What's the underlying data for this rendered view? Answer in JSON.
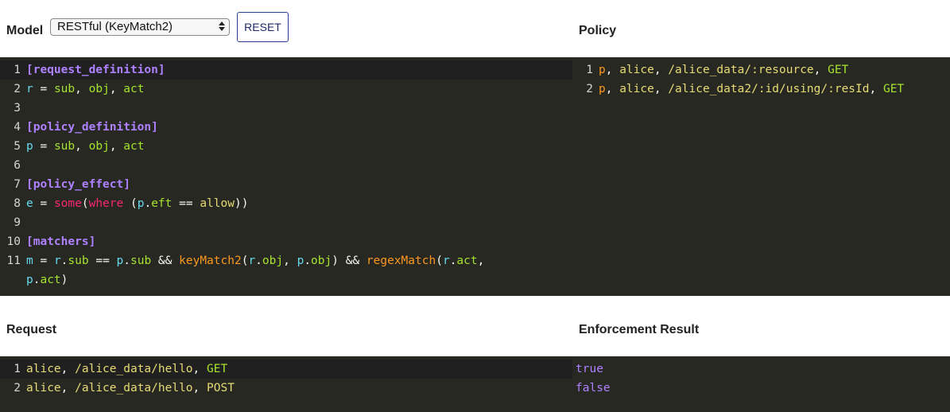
{
  "model": {
    "label": "Model",
    "selected": "RESTful (KeyMatch2)",
    "reset_label": "RESET"
  },
  "policy": {
    "label": "Policy"
  },
  "request": {
    "label": "Request"
  },
  "result": {
    "label": "Enforcement Result"
  },
  "model_lines": [
    {
      "n": "1",
      "tokens": [
        [
          "k",
          "[request_definition]"
        ]
      ]
    },
    {
      "n": "2",
      "tokens": [
        [
          "v",
          "r"
        ],
        [
          "op",
          " = "
        ],
        [
          "s",
          "sub"
        ],
        [
          "op",
          ", "
        ],
        [
          "s",
          "obj"
        ],
        [
          "op",
          ", "
        ],
        [
          "s",
          "act"
        ]
      ]
    },
    {
      "n": "3",
      "tokens": []
    },
    {
      "n": "4",
      "tokens": [
        [
          "k",
          "[policy_definition]"
        ]
      ]
    },
    {
      "n": "5",
      "tokens": [
        [
          "v",
          "p"
        ],
        [
          "op",
          " = "
        ],
        [
          "s",
          "sub"
        ],
        [
          "op",
          ", "
        ],
        [
          "s",
          "obj"
        ],
        [
          "op",
          ", "
        ],
        [
          "s",
          "act"
        ]
      ]
    },
    {
      "n": "6",
      "tokens": []
    },
    {
      "n": "7",
      "tokens": [
        [
          "k",
          "[policy_effect]"
        ]
      ]
    },
    {
      "n": "8",
      "tokens": [
        [
          "v",
          "e"
        ],
        [
          "op",
          " = "
        ],
        [
          "kw",
          "some"
        ],
        [
          "op",
          "("
        ],
        [
          "kw",
          "where"
        ],
        [
          "op",
          " ("
        ],
        [
          "v",
          "p"
        ],
        [
          "op",
          "."
        ],
        [
          "s",
          "eft"
        ],
        [
          "op",
          " == "
        ],
        [
          "str",
          "allow"
        ],
        [
          "op",
          "))"
        ]
      ]
    },
    {
      "n": "9",
      "tokens": []
    },
    {
      "n": "10",
      "tokens": [
        [
          "k",
          "[matchers]"
        ]
      ]
    },
    {
      "n": "11",
      "tokens": [
        [
          "v",
          "m"
        ],
        [
          "op",
          " = "
        ],
        [
          "v",
          "r"
        ],
        [
          "op",
          "."
        ],
        [
          "s",
          "sub"
        ],
        [
          "op",
          " == "
        ],
        [
          "v",
          "p"
        ],
        [
          "op",
          "."
        ],
        [
          "s",
          "sub"
        ],
        [
          "op",
          " && "
        ],
        [
          "f",
          "keyMatch2"
        ],
        [
          "op",
          "("
        ],
        [
          "v",
          "r"
        ],
        [
          "op",
          "."
        ],
        [
          "s",
          "obj"
        ],
        [
          "op",
          ", "
        ],
        [
          "v",
          "p"
        ],
        [
          "op",
          "."
        ],
        [
          "s",
          "obj"
        ],
        [
          "op",
          ") && "
        ],
        [
          "f",
          "regexMatch"
        ],
        [
          "op",
          "("
        ],
        [
          "v",
          "r"
        ],
        [
          "op",
          "."
        ],
        [
          "s",
          "act"
        ],
        [
          "op",
          ","
        ]
      ]
    },
    {
      "n": "",
      "tokens": [
        [
          "v",
          "p"
        ],
        [
          "op",
          "."
        ],
        [
          "s",
          "act"
        ],
        [
          "op",
          ")"
        ]
      ]
    }
  ],
  "policy_lines": [
    {
      "n": "1",
      "tokens": [
        [
          "pol",
          "p"
        ],
        [
          "op",
          ", "
        ],
        [
          "str",
          "alice"
        ],
        [
          "op",
          ", "
        ],
        [
          "str",
          "/alice_data/:resource"
        ],
        [
          "op",
          ", "
        ],
        [
          "s",
          "GET"
        ]
      ]
    },
    {
      "n": "2",
      "tokens": [
        [
          "pol",
          "p"
        ],
        [
          "op",
          ", "
        ],
        [
          "str",
          "alice"
        ],
        [
          "op",
          ", "
        ],
        [
          "str",
          "/alice_data2/:id/using/:resId"
        ],
        [
          "op",
          ", "
        ],
        [
          "s",
          "GET"
        ]
      ]
    }
  ],
  "request_lines": [
    {
      "n": "1",
      "tokens": [
        [
          "str",
          "alice"
        ],
        [
          "op",
          ", "
        ],
        [
          "str",
          "/alice_data/hello"
        ],
        [
          "op",
          ", "
        ],
        [
          "s",
          "GET"
        ]
      ]
    },
    {
      "n": "2",
      "tokens": [
        [
          "str",
          "alice"
        ],
        [
          "op",
          ", "
        ],
        [
          "str",
          "/alice_data/hello"
        ],
        [
          "op",
          ", "
        ],
        [
          "str",
          "POST"
        ]
      ]
    }
  ],
  "result_lines": [
    {
      "n": "",
      "tokens": [
        [
          "ok",
          "true"
        ]
      ]
    },
    {
      "n": "",
      "tokens": [
        [
          "ok",
          "false"
        ]
      ]
    }
  ]
}
